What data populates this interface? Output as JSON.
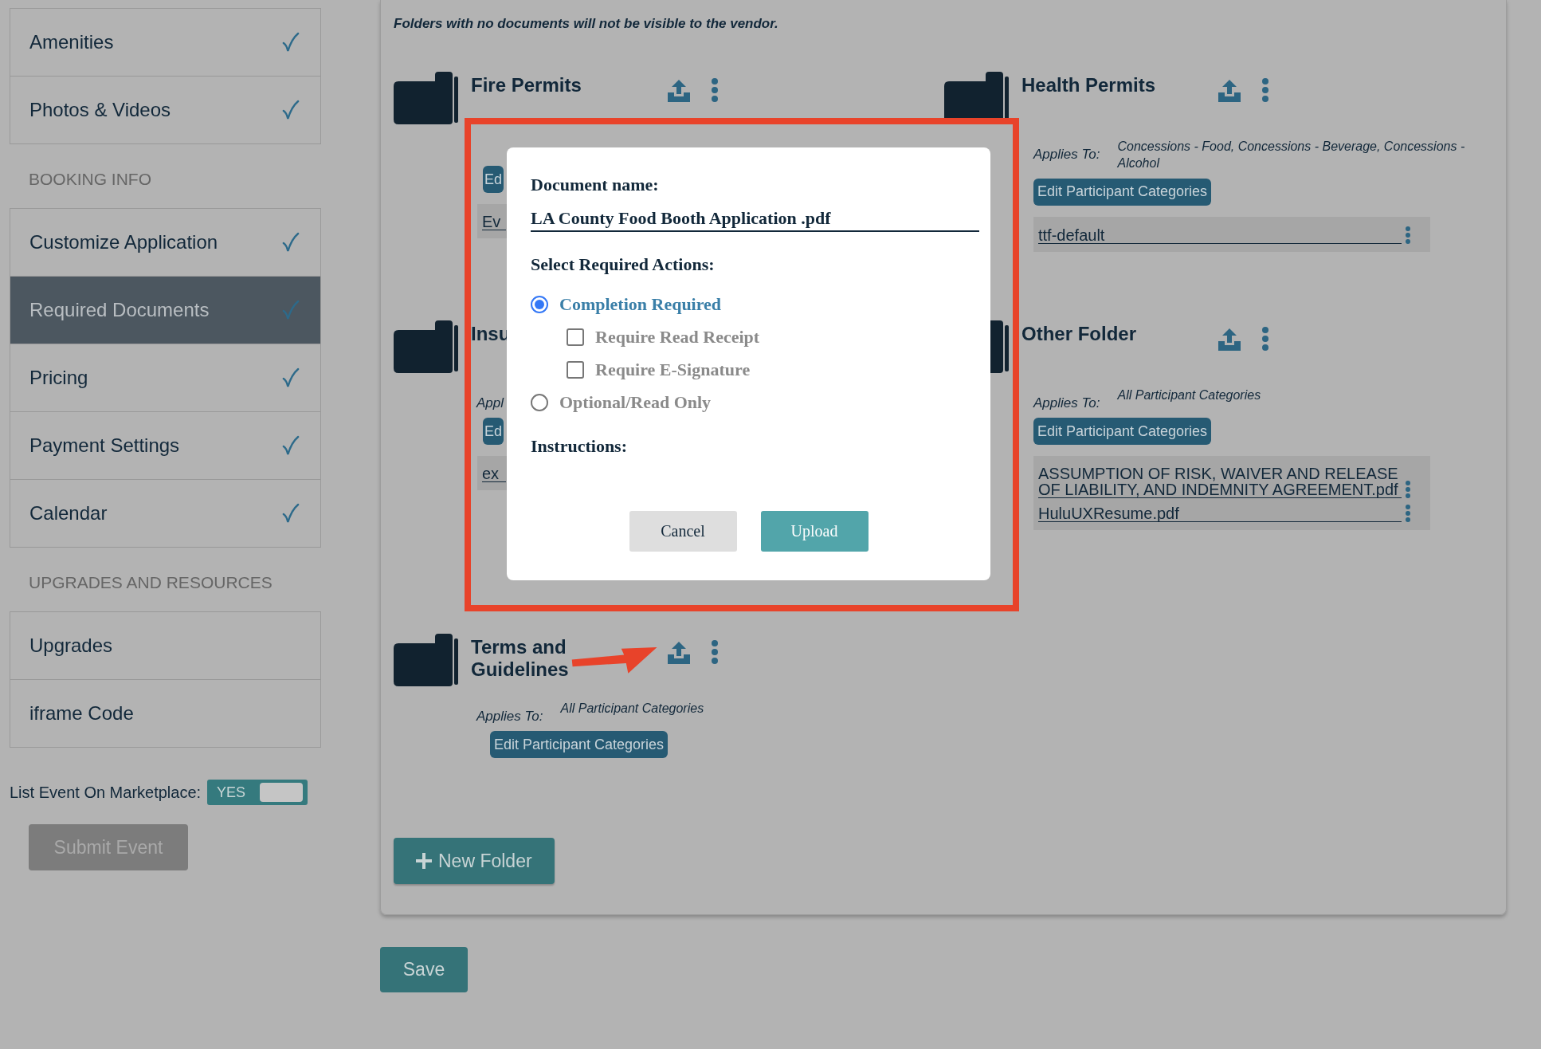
{
  "sidebar": {
    "sections": [
      {
        "items": [
          {
            "label": "Amenities",
            "checked": true,
            "selected": false
          },
          {
            "label": "Photos & Videos",
            "checked": true,
            "selected": false
          }
        ]
      },
      {
        "heading": "BOOKING INFO",
        "items": [
          {
            "label": "Customize Application",
            "checked": true,
            "selected": false
          },
          {
            "label": "Required Documents",
            "checked": true,
            "selected": true
          },
          {
            "label": "Pricing",
            "checked": true,
            "selected": false
          },
          {
            "label": "Payment Settings",
            "checked": true,
            "selected": false
          },
          {
            "label": "Calendar",
            "checked": true,
            "selected": false
          }
        ]
      },
      {
        "heading": "UPGRADES AND RESOURCES",
        "items": [
          {
            "label": "Upgrades",
            "checked": false,
            "selected": false
          },
          {
            "label": "iframe Code",
            "checked": false,
            "selected": false
          }
        ]
      }
    ],
    "marketplace": {
      "label": "List Event On Marketplace:",
      "toggle_label": "YES",
      "on": true
    },
    "submit_button": {
      "label": "Submit Event",
      "disabled": true
    }
  },
  "notice": "Folders with no documents will not be visible to the vendor.",
  "folder_columns": [
    {
      "folders": [
        {
          "title": "Fire Permits",
          "edit_button": "Ed",
          "documents": [
            {
              "name": "Ev"
            }
          ]
        },
        {
          "title": "Insu",
          "applies_label": "Appl",
          "edit_button": "Ed",
          "documents": [
            {
              "name": "ex"
            }
          ]
        },
        {
          "title": "Terms and Guidelines",
          "applies_label": "Applies To:",
          "applies_to": "All Participant Categories",
          "edit_button": "Edit Participant Categories"
        }
      ]
    },
    {
      "folders": [
        {
          "title": "Health Permits",
          "applies_label": "Applies To:",
          "applies_to": "Concessions - Food, Concessions - Beverage, Concessions - Alcohol",
          "edit_button": "Edit Participant Categories",
          "documents": [
            {
              "name": "ttf-default"
            }
          ]
        },
        {
          "title": "Other Folder",
          "applies_label": "Applies To:",
          "applies_to": "All Participant Categories",
          "edit_button": "Edit Participant Categories",
          "documents": [
            {
              "name": "ASSUMPTION OF RISK, WAIVER AND RELEASE OF LIABILITY, AND INDEMNITY AGREEMENT.pdf"
            },
            {
              "name": "HuluUXResume.pdf"
            }
          ]
        }
      ]
    }
  ],
  "new_folder_button": "New Folder",
  "save_button": "Save",
  "modal": {
    "doc_name_label": "Document name:",
    "doc_name_value": "LA County Food Booth Application .pdf",
    "actions_label": "Select Required Actions:",
    "options": [
      {
        "kind": "radio",
        "label": "Completion Required",
        "selected": true
      },
      {
        "kind": "checkbox",
        "label": "Require Read Receipt",
        "checked": false
      },
      {
        "kind": "checkbox",
        "label": "Require E-Signature",
        "checked": false
      },
      {
        "kind": "radio",
        "label": "Optional/Read Only",
        "selected": false
      }
    ],
    "instructions_label": "Instructions:",
    "buttons": [
      {
        "label": "Cancel",
        "kind": "secondary"
      },
      {
        "label": "Upload",
        "kind": "primary"
      }
    ]
  }
}
